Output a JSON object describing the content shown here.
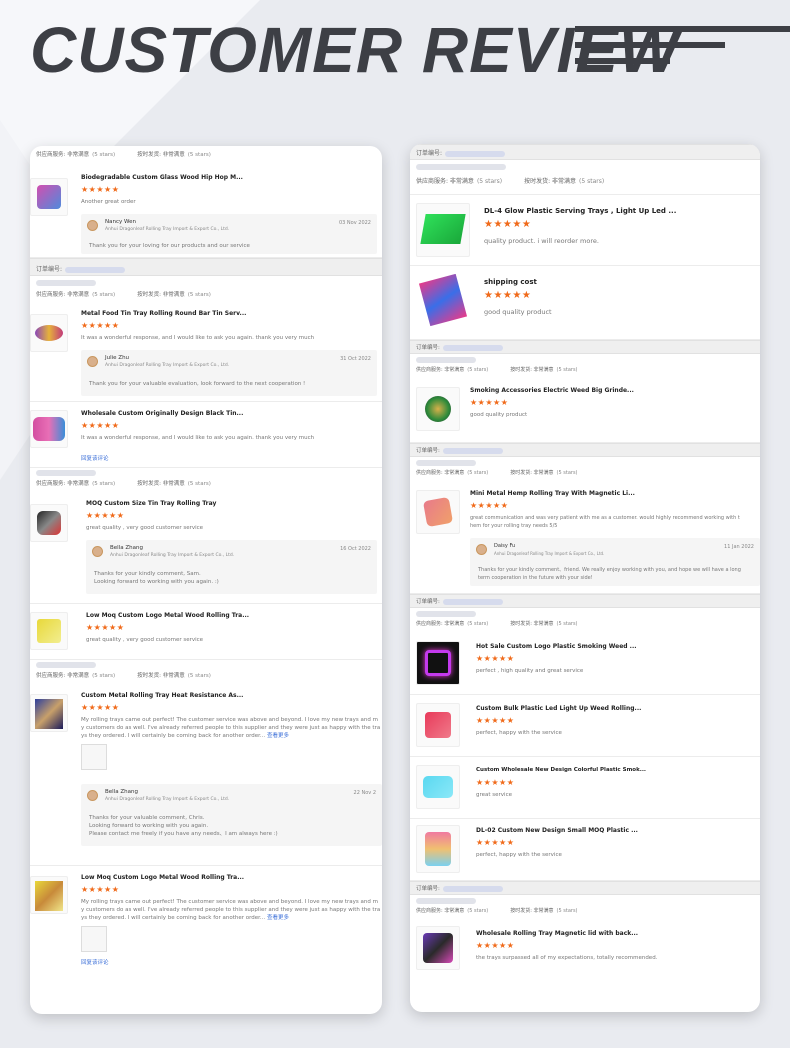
{
  "page_title": "CUSTOMER REVIEW",
  "service_label": "供应商服务: 非常满意",
  "service_stars": "(5 stars)",
  "delivery_label": "按时发货: 非常满意",
  "delivery_stars": "(5 stars)",
  "order_label": "订单编号:",
  "star_glyphs": "★★★★★",
  "fold_link": "回复该评论",
  "more_link": "查看更多",
  "left_reviews": [
    {
      "product": "Biodegradable Custom Glass Wood Hip Hop M...",
      "comment": "Another great order",
      "reply": {
        "name": "Nancy Wen",
        "company": "Anhui Dragonleaf Rolling Tray Import & Export Co., Ltd.",
        "date": "03 Nov 2022",
        "text": [
          "Thank you for your loving for our products and our service"
        ]
      }
    },
    {
      "product": "Metal Food Tin Tray Rolling Round Bar Tin Serv...",
      "comment": "It was a wonderful response, and I would like to ask you again. thank you very much",
      "reply": {
        "name": "Julie Zhu",
        "company": "Anhui Dragonleaf Rolling Tray Import & Export Co., Ltd.",
        "date": "31 Oct 2022",
        "text": [
          "Thank you for your valuable evaluation, look forward to the next cooperation !"
        ]
      }
    },
    {
      "product": "Wholesale Custom Originally Design Black Tin...",
      "comment": "It was a wonderful response, and I would like to ask you again. thank you very much"
    },
    {
      "product": "MOQ Custom Size Tin Tray Rolling Tray",
      "comment": "great quality , very good customer service",
      "reply": {
        "name": "Bella Zhang",
        "company": "Anhui Dragonleaf Rolling Tray Import & Export Co., Ltd.",
        "date": "16 Oct 2022",
        "text": [
          "Thanks for your kindly comment, Sam.",
          "Looking forward to working with you again.  :)"
        ]
      }
    },
    {
      "product": "Low Moq Custom Logo Metal Wood Rolling Tra...",
      "comment": "great quality , very good customer service"
    },
    {
      "product": "Custom Metal Rolling Tray Heat Resistance As...",
      "comment_lines": [
        "My rolling trays came out perfect! The customer service was above and beyond. I love my new trays and m",
        "y customers do as well. I've already referred people to this supplier and they were just as happy with the tra",
        "ys they ordered. I will certainly be coming back for another order..."
      ],
      "reply": {
        "name": "Bella Zhang",
        "company": "Anhui Dragonleaf Rolling Tray Import & Export Co., Ltd.",
        "date": "22 Nov 2",
        "text": [
          "Thanks for your valuable comment, Chris.",
          "Looking forward to working with you again.",
          "Please contact me freely if you have any needs、I am always here :)"
        ]
      }
    },
    {
      "product": "Low Moq Custom Logo Metal Wood Rolling Tra...",
      "comment_lines": [
        "My rolling trays came out perfect! The customer service was above and beyond. I love my new trays and m",
        "y customers do as well. I've already referred people to this supplier and they were just as happy with the tra",
        "ys they ordered. I will certainly be coming back for another order..."
      ]
    }
  ],
  "right_reviews": [
    {
      "product": "DL-4 Glow Plastic Serving Trays , Light Up Led ...",
      "comment": "quality product. i will reorder more."
    },
    {
      "product": "shipping cost",
      "comment": "good quality product"
    },
    {
      "product": "Smoking Accessories Electric Weed Big Grinde...",
      "comment": "good quality product"
    },
    {
      "product": "Mini Metal Hemp Rolling Tray With Magnetic Li...",
      "comment_lines": [
        "great communication and was very patient with me as a customer. would highly recommend working with t",
        "hem for your rolling tray needs 5/5"
      ],
      "reply": {
        "name": "Daisy Fu",
        "company": "Anhui Dragonleaf Rolling Tray Import & Export Co., Ltd.",
        "date": "11 Jan 2022",
        "text": [
          "Thanks for your kindly comment、friend.  We really enjoy working with you, and hope we will have a long",
          "term cooperation in the future with your side!"
        ]
      }
    },
    {
      "product": "Hot Sale Custom Logo Plastic Smoking Weed ...",
      "comment": "perfect , high quality and great service"
    },
    {
      "product": "Custom Bulk Plastic Led Light Up Weed Rolling...",
      "comment": "perfect, happy with the service"
    },
    {
      "product": "Custom Wholesale New Design Colorful Plastic Smok...",
      "comment": "great service"
    },
    {
      "product": "DL-02 Custom New Design Small MOQ Plastic ...",
      "comment": "perfect, happy with the service"
    },
    {
      "product": "Wholesale Rolling Tray Magnetic lid with back...",
      "comment": "the trays surpassed all of my expectations, totally recommended."
    }
  ]
}
